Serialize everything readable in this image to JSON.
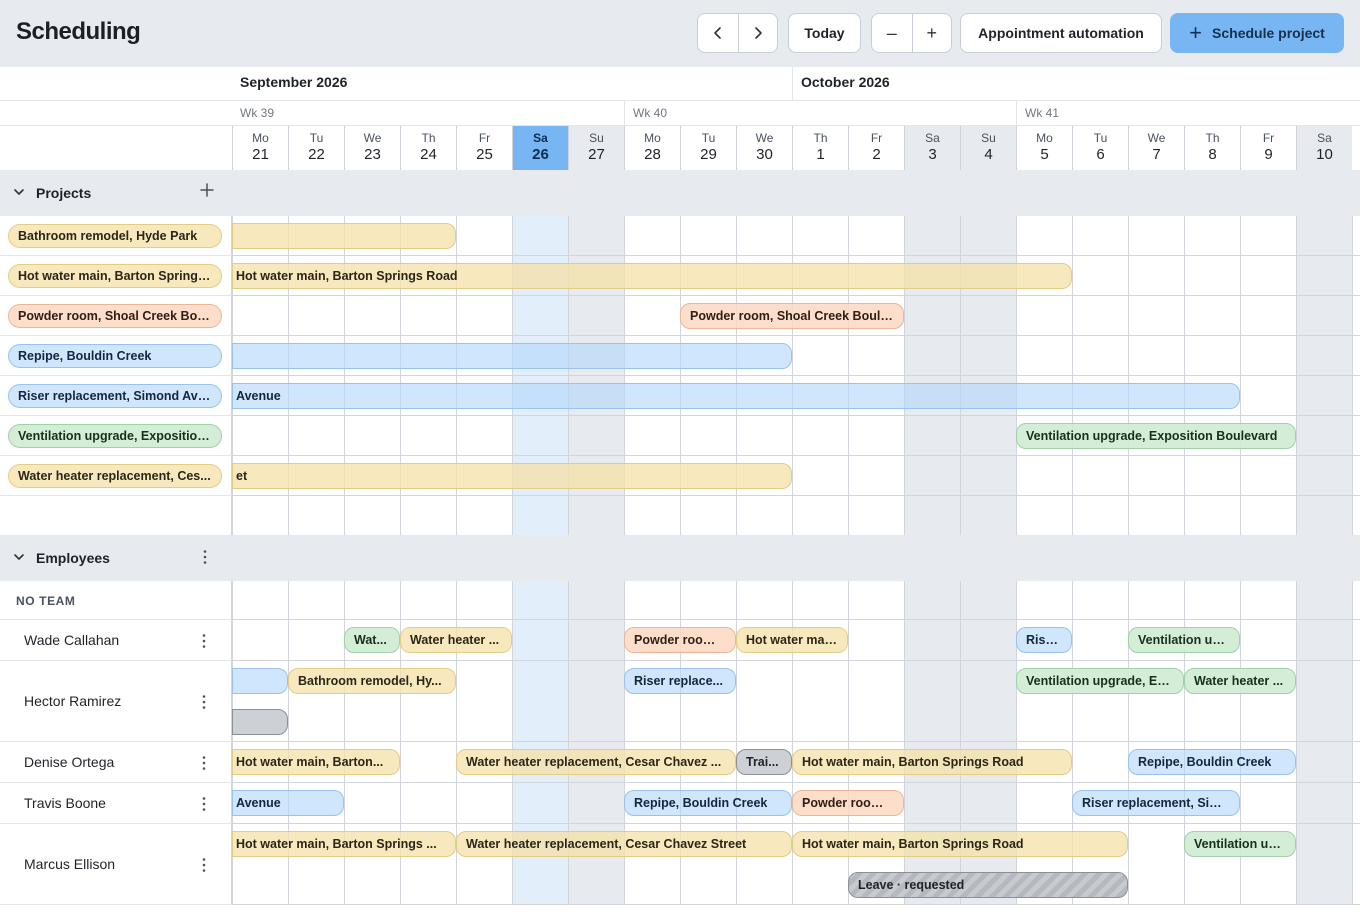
{
  "header": {
    "title": "Scheduling",
    "prev_icon": "chevron-left-icon",
    "next_icon": "chevron-right-icon",
    "today_label": "Today",
    "zoom_out_label": "–",
    "zoom_in_label": "+",
    "automation_label": "Appointment automation",
    "schedule_label": "Schedule project",
    "schedule_icon": "plus-icon"
  },
  "months": [
    {
      "label": "September 2026"
    },
    {
      "label": "October 2026"
    }
  ],
  "weeks": [
    "Wk 39",
    "Wk 40",
    "Wk 41"
  ],
  "days": [
    {
      "abbr": "Mo",
      "num": "21",
      "weekend": false,
      "today": false
    },
    {
      "abbr": "Tu",
      "num": "22",
      "weekend": false,
      "today": false
    },
    {
      "abbr": "We",
      "num": "23",
      "weekend": false,
      "today": false
    },
    {
      "abbr": "Th",
      "num": "24",
      "weekend": false,
      "today": false
    },
    {
      "abbr": "Fr",
      "num": "25",
      "weekend": false,
      "today": false
    },
    {
      "abbr": "Sa",
      "num": "26",
      "weekend": true,
      "today": true
    },
    {
      "abbr": "Su",
      "num": "27",
      "weekend": true,
      "today": false
    },
    {
      "abbr": "Mo",
      "num": "28",
      "weekend": false,
      "today": false
    },
    {
      "abbr": "Tu",
      "num": "29",
      "weekend": false,
      "today": false
    },
    {
      "abbr": "We",
      "num": "30",
      "weekend": false,
      "today": false
    },
    {
      "abbr": "Th",
      "num": "1",
      "weekend": false,
      "today": false
    },
    {
      "abbr": "Fr",
      "num": "2",
      "weekend": false,
      "today": false
    },
    {
      "abbr": "Sa",
      "num": "3",
      "weekend": true,
      "today": false
    },
    {
      "abbr": "Su",
      "num": "4",
      "weekend": true,
      "today": false
    },
    {
      "abbr": "Mo",
      "num": "5",
      "weekend": false,
      "today": false
    },
    {
      "abbr": "Tu",
      "num": "6",
      "weekend": false,
      "today": false
    },
    {
      "abbr": "We",
      "num": "7",
      "weekend": false,
      "today": false
    },
    {
      "abbr": "Th",
      "num": "8",
      "weekend": false,
      "today": false
    },
    {
      "abbr": "Fr",
      "num": "9",
      "weekend": false,
      "today": false
    },
    {
      "abbr": "Sa",
      "num": "10",
      "weekend": true,
      "today": false
    }
  ],
  "projects_section": {
    "title": "Projects",
    "collapse_icon": "chevron-down-icon",
    "add_icon": "plus-icon"
  },
  "colors": {
    "yellow": "#f5e2aa",
    "blue": "#b2d6fa",
    "orange": "#fbd8c2",
    "green": "#ceebd2",
    "gray": "#cdd0d4",
    "today": "#77b5f3"
  },
  "projects": [
    {
      "name": "Bathroom remodel, Hyde Park",
      "display": "Bathroom remodel, Hyde Park",
      "color": "yellow",
      "bars": [
        {
          "start": 0,
          "end": 3,
          "label": "",
          "flat_left": true
        }
      ]
    },
    {
      "name": "Hot water main, Barton Springs Road",
      "display": "Hot water main, Barton Springs...",
      "color": "yellow",
      "bars": [
        {
          "start": 0,
          "end": 14,
          "label": "Hot water main, Barton Springs Road",
          "flat_left": true
        }
      ]
    },
    {
      "name": "Powder room, Shoal Creek Boulevard",
      "display": "Powder room, Shoal Creek Boul...",
      "color": "orange",
      "bars": [
        {
          "start": 8,
          "end": 11,
          "label": "Powder room, Shoal Creek Boule...",
          "flat_left": false
        }
      ]
    },
    {
      "name": "Repipe, Bouldin Creek",
      "display": "Repipe, Bouldin Creek",
      "color": "blue",
      "bars": [
        {
          "start": 0,
          "end": 9,
          "label": "",
          "flat_left": true
        }
      ]
    },
    {
      "name": "Riser replacement, Simond Avenue",
      "display": "Riser replacement, Simond Ave...",
      "color": "blue",
      "bars": [
        {
          "start": 0,
          "end": 17,
          "label": "Avenue",
          "flat_left": true
        }
      ]
    },
    {
      "name": "Ventilation upgrade, Exposition Boulevard",
      "display": "Ventilation upgrade, Exposition...",
      "color": "green",
      "bars": [
        {
          "start": 14,
          "end": 18,
          "label": "Ventilation upgrade, Exposition Boulevard",
          "flat_left": false
        }
      ]
    },
    {
      "name": "Water heater replacement, Cesar Chavez Street",
      "display": "Water heater replacement, Ces...",
      "color": "yellow",
      "bars": [
        {
          "start": 0,
          "end": 9,
          "label": "et",
          "flat_left": true
        }
      ]
    }
  ],
  "employees_section": {
    "title": "Employees",
    "collapse_icon": "chevron-down-icon",
    "more_icon": "more-vertical-icon",
    "team_label": "NO TEAM"
  },
  "employees": [
    {
      "name": "Wade Callahan",
      "lanes": 1,
      "bars": [
        {
          "start": 2,
          "end": 2,
          "lane": 0,
          "color": "green",
          "label": "Wat..."
        },
        {
          "start": 3,
          "end": 4,
          "lane": 0,
          "color": "yellow",
          "label": "Water heater ..."
        },
        {
          "start": 7,
          "end": 8,
          "lane": 0,
          "color": "orange",
          "label": "Powder room,..."
        },
        {
          "start": 9,
          "end": 10,
          "lane": 0,
          "color": "yellow",
          "label": "Hot water mai..."
        },
        {
          "start": 14,
          "end": 14,
          "lane": 0,
          "color": "blue",
          "label": "Rise..."
        },
        {
          "start": 16,
          "end": 17,
          "lane": 0,
          "color": "green",
          "label": "Ventilation up..."
        }
      ]
    },
    {
      "name": "Hector Ramirez",
      "lanes": 2,
      "bars": [
        {
          "start": 0,
          "end": 0,
          "lane": 0,
          "color": "blue",
          "label": "",
          "flat_left": true
        },
        {
          "start": 1,
          "end": 3,
          "lane": 0,
          "color": "yellow",
          "label": "Bathroom remodel, Hy..."
        },
        {
          "start": 7,
          "end": 8,
          "lane": 0,
          "color": "blue",
          "label": "Riser replace..."
        },
        {
          "start": 14,
          "end": 16,
          "lane": 0,
          "color": "green",
          "label": "Ventilation upgrade, Ex..."
        },
        {
          "start": 17,
          "end": 18,
          "lane": 0,
          "color": "green",
          "label": "Water heater ..."
        },
        {
          "start": 0,
          "end": 0,
          "lane": 1,
          "color": "gray",
          "label": "",
          "flat_left": true
        }
      ]
    },
    {
      "name": "Denise Ortega",
      "lanes": 1,
      "bars": [
        {
          "start": 0,
          "end": 2,
          "lane": 0,
          "color": "yellow",
          "label": "Hot water main, Barton...",
          "flat_left": true
        },
        {
          "start": 4,
          "end": 8,
          "lane": 0,
          "color": "yellow",
          "label": "Water heater replacement, Cesar Chavez ..."
        },
        {
          "start": 9,
          "end": 9,
          "lane": 0,
          "color": "gray",
          "label": "Trai..."
        },
        {
          "start": 10,
          "end": 14,
          "lane": 0,
          "color": "yellow",
          "label": "Hot water main, Barton Springs Road"
        },
        {
          "start": 16,
          "end": 18,
          "lane": 0,
          "color": "blue",
          "label": "Repipe, Bouldin Creek"
        }
      ]
    },
    {
      "name": "Travis Boone",
      "lanes": 1,
      "bars": [
        {
          "start": 0,
          "end": 1,
          "lane": 0,
          "color": "blue",
          "label": "Avenue",
          "flat_left": true
        },
        {
          "start": 7,
          "end": 9,
          "lane": 0,
          "color": "blue",
          "label": "Repipe, Bouldin Creek"
        },
        {
          "start": 10,
          "end": 11,
          "lane": 0,
          "color": "orange",
          "label": "Powder room,..."
        },
        {
          "start": 15,
          "end": 17,
          "lane": 0,
          "color": "blue",
          "label": "Riser replacement, Sim..."
        }
      ]
    },
    {
      "name": "Marcus Ellison",
      "lanes": 2,
      "bars": [
        {
          "start": 0,
          "end": 3,
          "lane": 0,
          "color": "yellow",
          "label": "Hot water main, Barton Springs ...",
          "flat_left": true
        },
        {
          "start": 4,
          "end": 9,
          "lane": 0,
          "color": "yellow",
          "label": "Water heater replacement, Cesar Chavez Street"
        },
        {
          "start": 10,
          "end": 15,
          "lane": 0,
          "color": "yellow",
          "label": "Hot water main, Barton Springs Road"
        },
        {
          "start": 17,
          "end": 18,
          "lane": 0,
          "color": "green",
          "label": "Ventilation up..."
        },
        {
          "start": 11,
          "end": 15,
          "lane": 1,
          "color": "leave",
          "label": "Leave · requested"
        }
      ]
    }
  ]
}
